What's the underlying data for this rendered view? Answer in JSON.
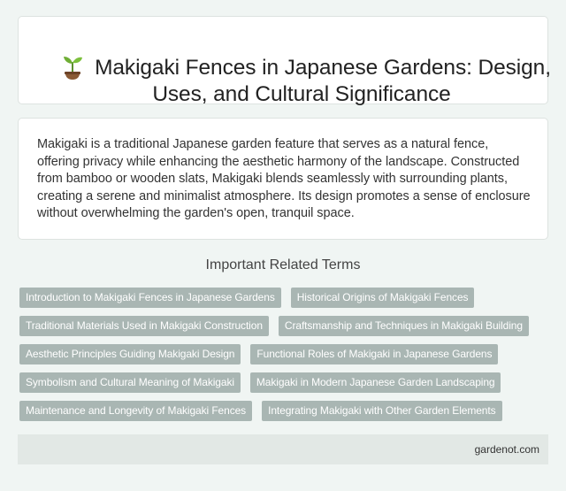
{
  "header": {
    "icon": "sprout-icon",
    "title_line1": "Makigaki Fences in Japanese Gardens: Design,",
    "title_line2": "Uses, and Cultural Significance"
  },
  "summary": {
    "text": "Makigaki is a traditional Japanese garden feature that serves as a natural fence, offering privacy while enhancing the aesthetic harmony of the landscape. Constructed from bamboo or wooden slats, Makigaki blends seamlessly with surrounding plants, creating a serene and minimalist atmosphere. Its design promotes a sense of enclosure without overwhelming the garden's open, tranquil space."
  },
  "related": {
    "heading": "Important Related Terms",
    "tags": [
      "Introduction to Makigaki Fences in Japanese Gardens",
      "Historical Origins of Makigaki Fences",
      "Traditional Materials Used in Makigaki Construction",
      "Craftsmanship and Techniques in Makigaki Building",
      "Aesthetic Principles Guiding Makigaki Design",
      "Functional Roles of Makigaki in Japanese Gardens",
      "Symbolism and Cultural Meaning of Makigaki",
      "Makigaki in Modern Japanese Garden Landscaping",
      "Maintenance and Longevity of Makigaki Fences",
      "Integrating Makigaki with Other Garden Elements"
    ]
  },
  "footer": {
    "site": "gardenot.com"
  },
  "colors": {
    "page_background": "#f0f5f3",
    "tag_background": "#a9b6b3",
    "footer_background": "#e2e8e5"
  }
}
